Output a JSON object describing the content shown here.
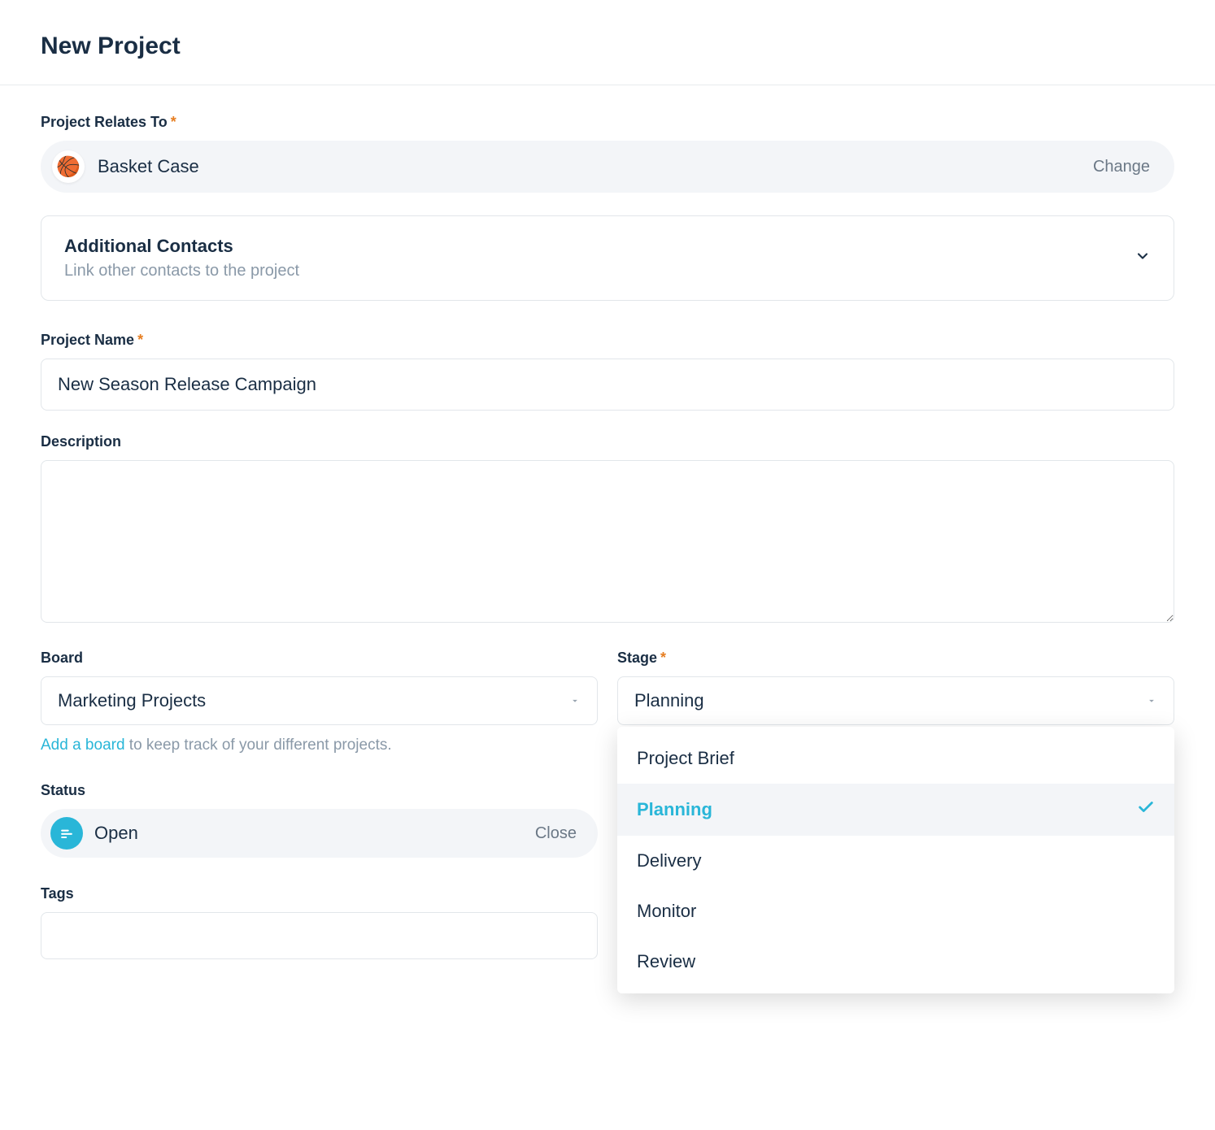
{
  "header": {
    "title": "New Project"
  },
  "relates": {
    "label": "Project Relates To",
    "name": "Basket Case",
    "change": "Change"
  },
  "additional": {
    "title": "Additional Contacts",
    "subtitle": "Link other contacts to the project"
  },
  "projectName": {
    "label": "Project Name",
    "value": "New Season Release Campaign"
  },
  "description": {
    "label": "Description",
    "value": ""
  },
  "board": {
    "label": "Board",
    "selected": "Marketing Projects",
    "helper_link": "Add a board",
    "helper_text": " to keep track of your different projects."
  },
  "stage": {
    "label": "Stage",
    "selected": "Planning",
    "options": [
      "Project Brief",
      "Planning",
      "Delivery",
      "Monitor",
      "Review"
    ]
  },
  "status": {
    "label": "Status",
    "value": "Open",
    "action": "Close"
  },
  "tags": {
    "label": "Tags"
  }
}
